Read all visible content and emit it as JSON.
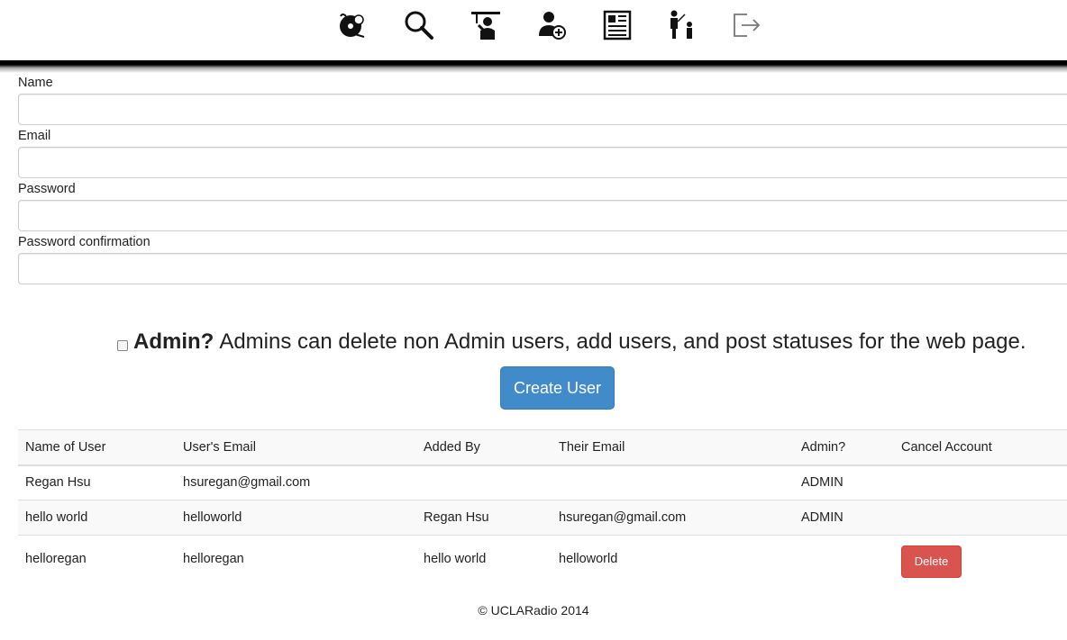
{
  "nav": {
    "icons": [
      "music-library-icon",
      "search-icon",
      "dj-lecture-icon",
      "add-user-icon",
      "news-icon",
      "staff-icon",
      "logout-icon"
    ]
  },
  "form": {
    "name_label": "Name",
    "email_label": "Email",
    "password_label": "Password",
    "password_confirmation_label": "Password confirmation",
    "admin_title": "Admin?",
    "admin_description": "Admins can delete non Admin users, add users, and post statuses for the web page.",
    "submit_label": "Create User"
  },
  "table": {
    "headers": [
      "Name of User",
      "User's Email",
      "Added By",
      "Their Email",
      "Admin?",
      "Cancel Account"
    ],
    "rows": [
      {
        "name": "Regan Hsu",
        "email": "hsuregan@gmail.com",
        "added_by": "",
        "their_email": "",
        "admin": "ADMIN",
        "cancel": ""
      },
      {
        "name": "hello world",
        "email": "helloworld",
        "added_by": "Regan Hsu",
        "their_email": "hsuregan@gmail.com",
        "admin": "ADMIN",
        "cancel": ""
      },
      {
        "name": "helloregan",
        "email": "helloregan",
        "added_by": "hello world",
        "their_email": "helloworld",
        "admin": "",
        "cancel": "Delete"
      }
    ]
  },
  "footer": {
    "text": "© UCLARadio 2014"
  },
  "colors": {
    "primary_button": "#428bca",
    "danger_button": "#d9534f",
    "nav_bar": "#000000"
  }
}
